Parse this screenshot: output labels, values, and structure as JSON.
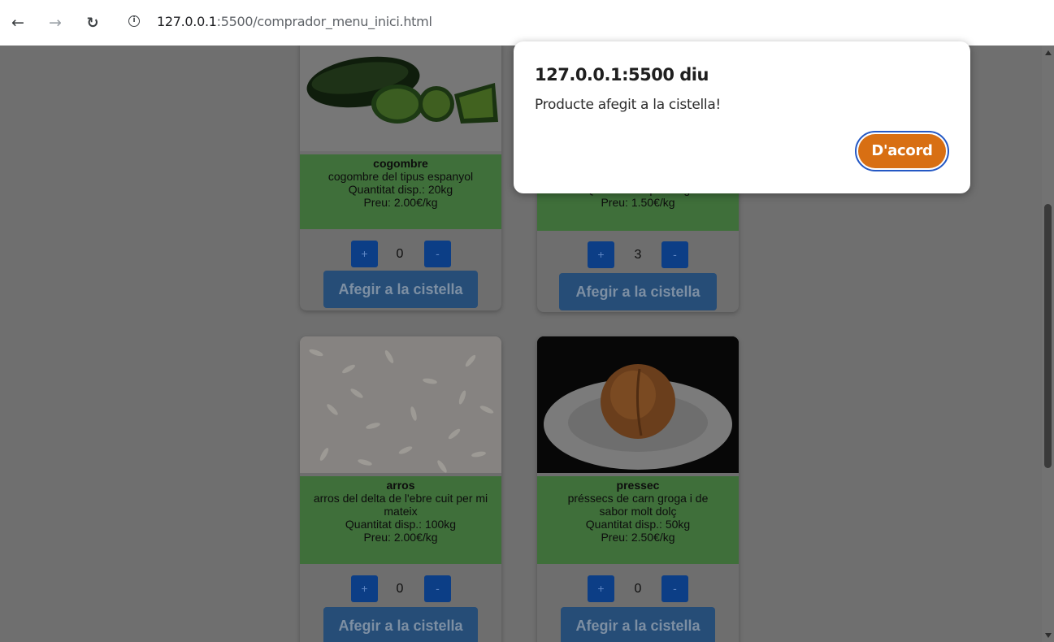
{
  "browser": {
    "url_host": "127.0.0.1",
    "url_rest": ":5500/comprador_menu_inici.html"
  },
  "dialog": {
    "title": "127.0.0.1:5500 diu",
    "message": "Producte afegit a la cistella!",
    "ok_label": "D'acord",
    "ok_color": "#d86f13"
  },
  "products": [
    {
      "name": "cogombre",
      "description": "cogombre del tipus espanyol",
      "stock": "Quantitat disp.: 20kg",
      "price": "Preu: 2.00€/kg",
      "qty": "0",
      "add_label": "Afegir a la cistella",
      "image": "cucumber-image"
    },
    {
      "name": "",
      "description": "",
      "stock": "Quantitat disp.: 10kg",
      "price": "Preu: 1.50€/kg",
      "qty": "3",
      "add_label": "Afegir a la cistella",
      "image": "hidden-image"
    },
    {
      "name": "arros",
      "description": "arros del delta de l'ebre cuit per mi mateix",
      "stock": "Quantitat disp.: 100kg",
      "price": "Preu: 2.00€/kg",
      "qty": "0",
      "add_label": "Afegir a la cistella",
      "image": "rice-image"
    },
    {
      "name": "pressec",
      "description": "préssecs de carn groga i de sabor molt dolç",
      "stock": "Quantitat disp.: 50kg",
      "price": "Preu: 2.50€/kg",
      "qty": "0",
      "add_label": "Afegir a la cistella",
      "image": "peach-image"
    }
  ],
  "qty_controls": {
    "plus": "+",
    "minus": "-"
  }
}
